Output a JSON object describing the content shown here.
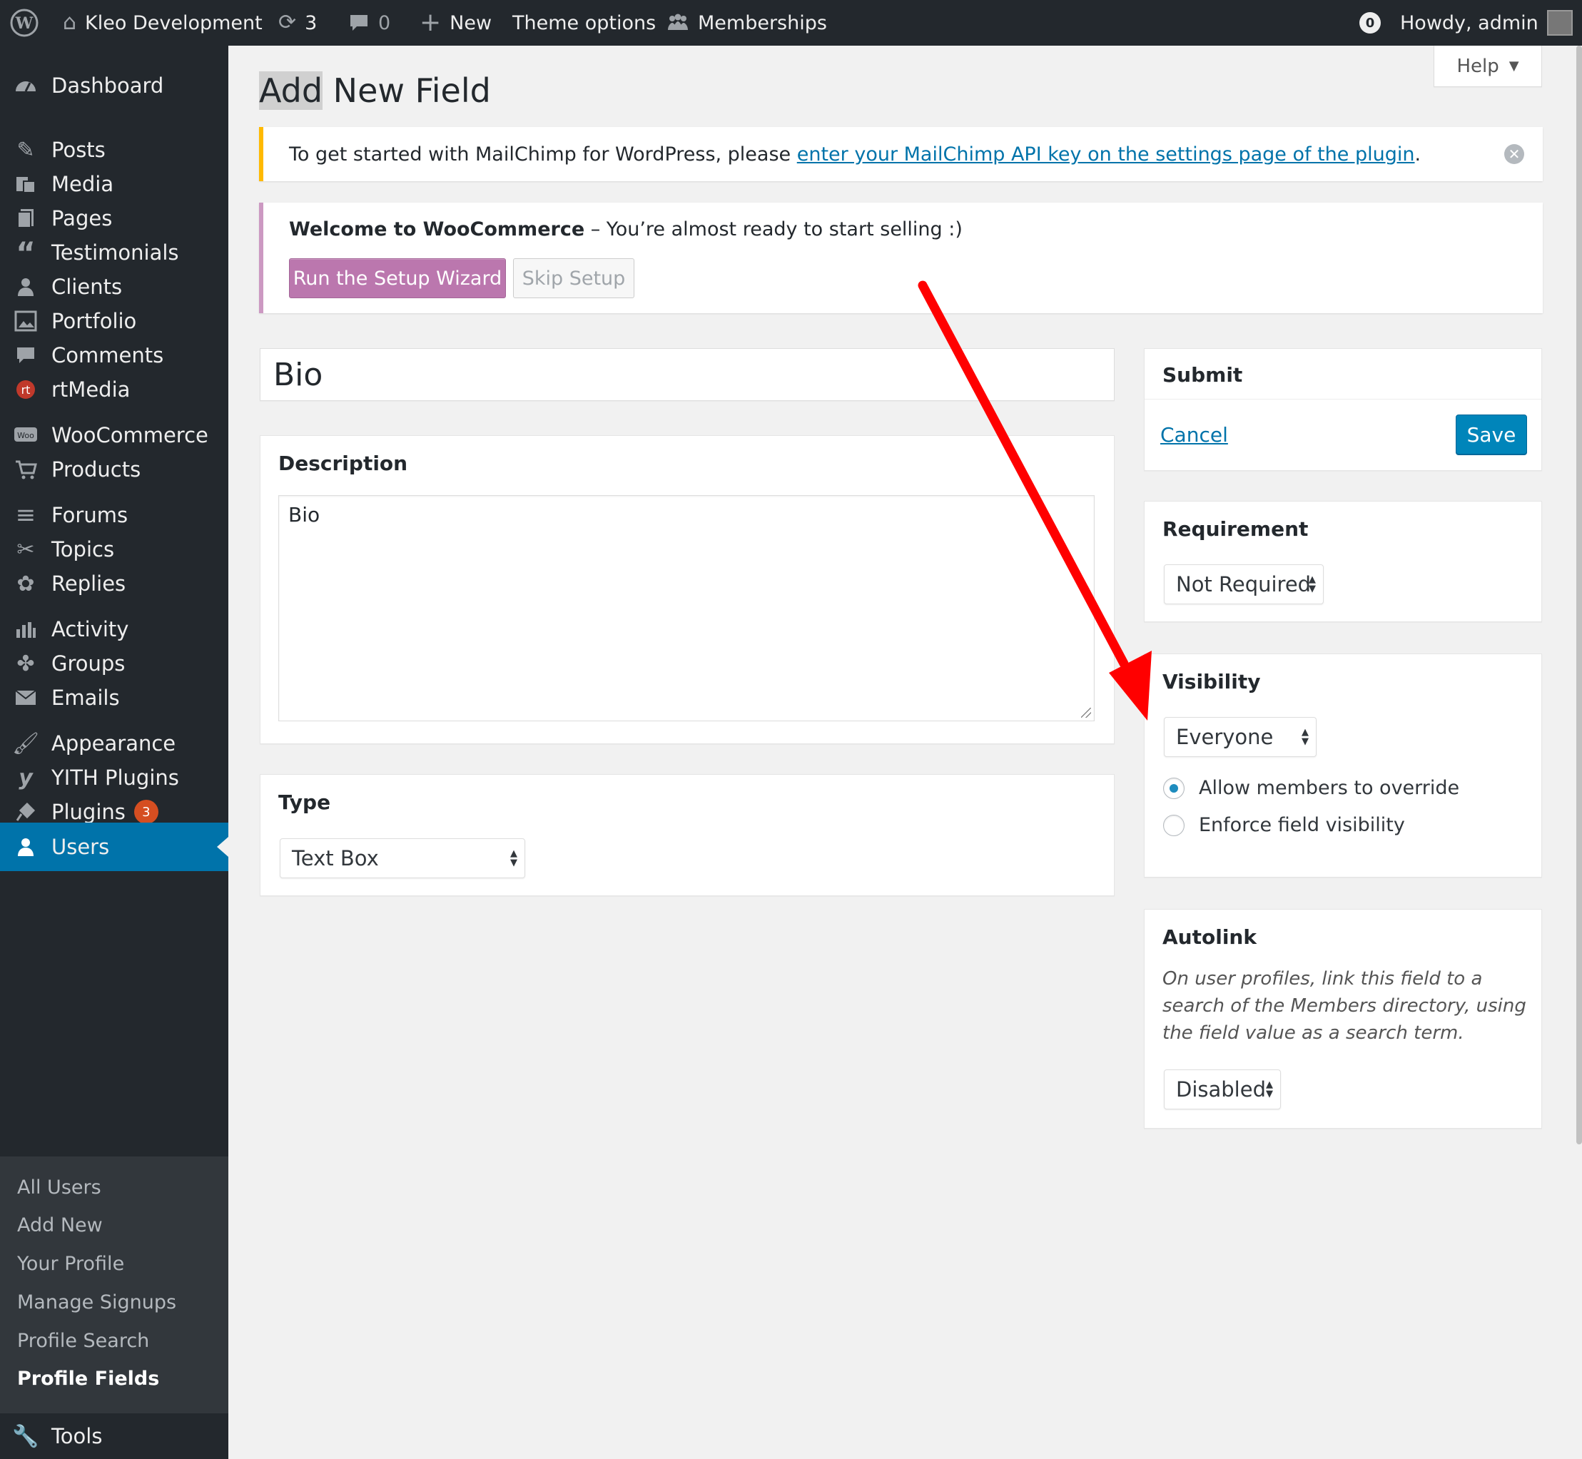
{
  "adminbar": {
    "site_name": "Kleo Development",
    "updates_count": "3",
    "comments_count": "0",
    "new_label": "New",
    "theme_options_label": "Theme options",
    "memberships_label": "Memberships",
    "notif_count": "0",
    "howdy": "Howdy, admin"
  },
  "sidebar": {
    "dashboard": "Dashboard",
    "posts": "Posts",
    "media": "Media",
    "pages": "Pages",
    "testimonials": "Testimonials",
    "clients": "Clients",
    "portfolio": "Portfolio",
    "comments": "Comments",
    "rtmedia": "rtMedia",
    "woocommerce": "WooCommerce",
    "products": "Products",
    "forums": "Forums",
    "topics": "Topics",
    "replies": "Replies",
    "activity": "Activity",
    "groups": "Groups",
    "emails": "Emails",
    "appearance": "Appearance",
    "yith": "YITH Plugins",
    "plugins": "Plugins",
    "plugins_badge": "3",
    "users": "Users",
    "tools": "Tools",
    "submenu": {
      "all_users": "All Users",
      "add_new": "Add New",
      "your_profile": "Your Profile",
      "manage_signups": "Manage Signups",
      "profile_search": "Profile Search",
      "profile_fields": "Profile Fields"
    }
  },
  "page": {
    "title_highlight": "Add",
    "title_rest": " New Field",
    "help_label": "Help"
  },
  "mailchimp_notice": {
    "text": "To get started with MailChimp for WordPress, please ",
    "link": "enter your MailChimp API key on the settings page of the plugin",
    "suffix": "."
  },
  "woo_notice": {
    "strong": "Welcome to WooCommerce",
    "text": " – You’re almost ready to start selling :)",
    "setup_button": "Run the Setup Wizard",
    "skip_button": "Skip Setup"
  },
  "field": {
    "name_value": "Bio",
    "description_heading": "Description",
    "description_value": "Bio",
    "type_heading": "Type",
    "type_value": "Text Box"
  },
  "submit_box": {
    "heading": "Submit",
    "cancel": "Cancel",
    "save": "Save"
  },
  "requirement_box": {
    "heading": "Requirement",
    "value": "Not Required"
  },
  "visibility_box": {
    "heading": "Visibility",
    "value": "Everyone",
    "option_override": "Allow members to override",
    "option_enforce": "Enforce field visibility"
  },
  "autolink_box": {
    "heading": "Autolink",
    "description": "On user profiles, link this field to a search of the Members directory, using the field value as a search term.",
    "value": "Disabled"
  },
  "colors": {
    "admin_bg": "#23282d",
    "accent": "#0073aa",
    "woo_purple": "#bb77ae",
    "annotation_arrow": "#ff0000"
  },
  "icons": [
    "wordpress-icon",
    "home-icon",
    "updates-icon",
    "comment-icon",
    "plus-icon",
    "memberships-icon",
    "user-icon"
  ]
}
